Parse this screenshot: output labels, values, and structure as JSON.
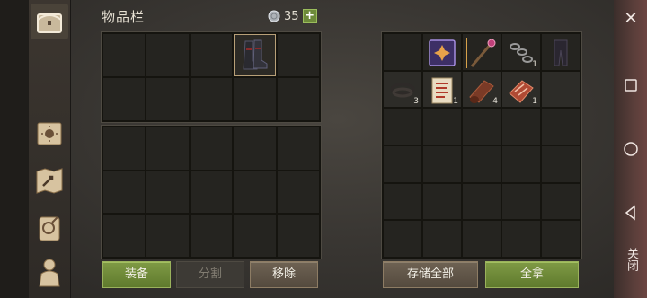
{
  "header": {
    "title": "物品栏",
    "currency_amount": "35",
    "add_symbol": "+"
  },
  "inventory": {
    "equipped_item": {
      "icon": "boots-icon"
    }
  },
  "storage": {
    "items": [
      {
        "icon": "spellbook-icon",
        "qty": ""
      },
      {
        "icon": "magic-staff-icon",
        "qty": ""
      },
      {
        "icon": "chain-icon",
        "qty": "1"
      },
      {
        "icon": "pants-icon",
        "qty": ""
      },
      {
        "icon": "rope-icon",
        "qty": "3"
      },
      {
        "icon": "scroll-icon",
        "qty": "1"
      },
      {
        "icon": "leather-roll-icon",
        "qty": "4"
      },
      {
        "icon": "meat-slab-icon",
        "qty": "1"
      }
    ]
  },
  "buttons": {
    "equip": "装备",
    "split": "分割",
    "remove": "移除",
    "store_all": "存储全部",
    "take_all": "全拿"
  },
  "navbar": {
    "close_label": "关闭",
    "x": "✕"
  },
  "colors": {
    "accent_green": "#6d8a3a",
    "brown_button": "#6e6253",
    "selection_outline": "#b8a078"
  }
}
